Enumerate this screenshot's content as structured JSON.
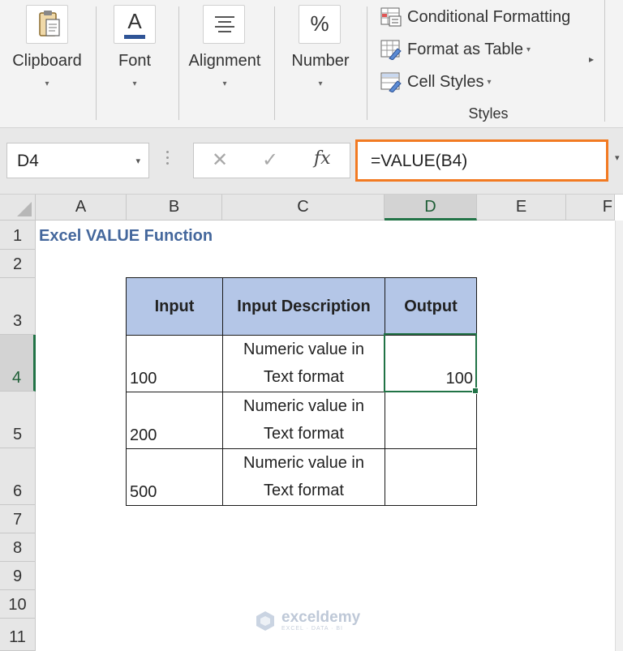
{
  "ribbon": {
    "groups": [
      {
        "label": "Clipboard",
        "icon": "clipboard-icon"
      },
      {
        "label": "Font",
        "icon": "font-color-icon"
      },
      {
        "label": "Alignment",
        "icon": "align-lines-icon"
      },
      {
        "label": "Number",
        "icon": "percent-icon"
      }
    ],
    "styles": {
      "label": "Styles",
      "items": [
        {
          "label": "Conditional Formatting",
          "icon": "conditional-formatting-icon",
          "dropdown": false
        },
        {
          "label": "Format as Table",
          "icon": "format-as-table-icon",
          "dropdown": true
        },
        {
          "label": "Cell Styles",
          "icon": "cell-styles-icon",
          "dropdown": true
        }
      ]
    },
    "font_glyph": "A",
    "number_glyph": "%",
    "scroll_glyph": "▸",
    "caret_glyph": "▾"
  },
  "formula_bar": {
    "name_box": "D4",
    "cancel_glyph": "✕",
    "enter_glyph": "✓",
    "fx_label": "fx",
    "formula": "=VALUE(B4)",
    "accent_color": "#f27a22"
  },
  "sheet": {
    "columns": [
      "A",
      "B",
      "C",
      "D",
      "E",
      "F"
    ],
    "rows": [
      "1",
      "2",
      "3",
      "4",
      "5",
      "6",
      "7",
      "8",
      "9",
      "10",
      "11"
    ],
    "active_column": "D",
    "active_row": "4",
    "title": "Excel VALUE Function",
    "table": {
      "headers": [
        "Input",
        "Input Description",
        "Output"
      ],
      "rows": [
        {
          "input": "100",
          "desc_line1": "Numeric value in",
          "desc_line2": "Text format",
          "output": "100"
        },
        {
          "input": "200",
          "desc_line1": "Numeric value in",
          "desc_line2": "Text format",
          "output": ""
        },
        {
          "input": "500",
          "desc_line1": "Numeric value in",
          "desc_line2": "Text format",
          "output": ""
        }
      ],
      "header_color": "#b4c6e7"
    },
    "selection_color": "#217346"
  },
  "watermark": {
    "name": "exceldemy",
    "tagline": "EXCEL · DATA · BI"
  }
}
